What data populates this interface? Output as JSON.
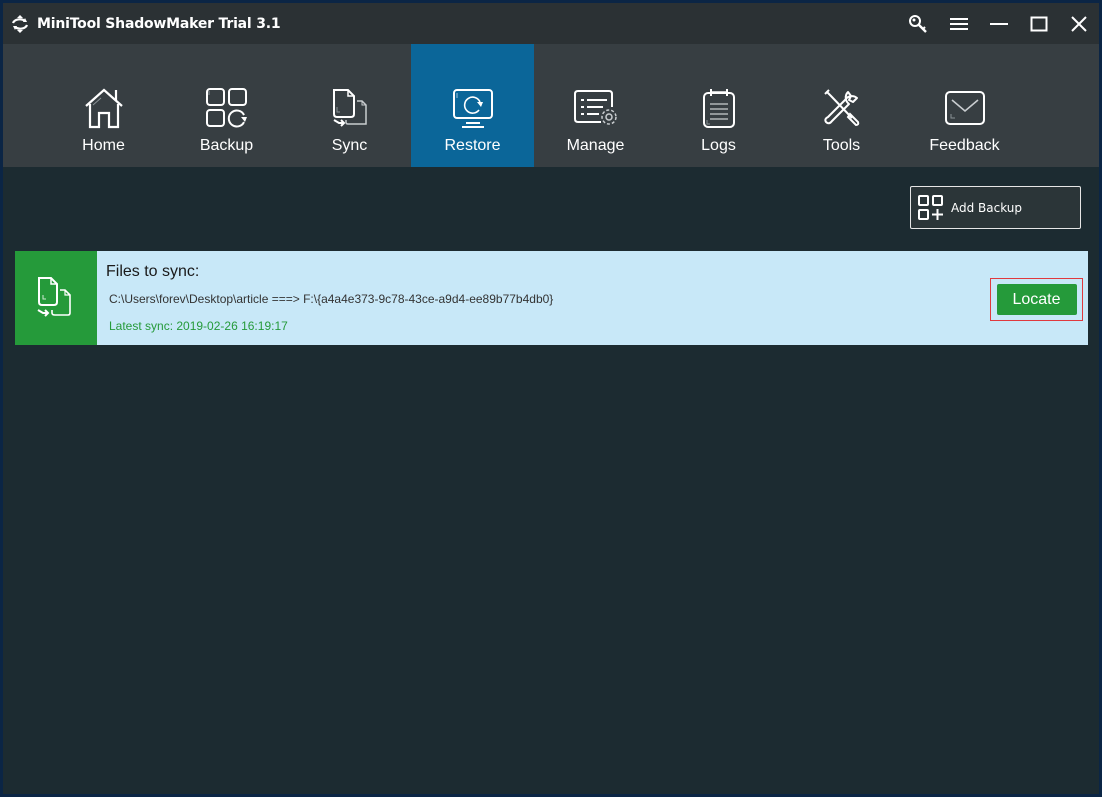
{
  "window": {
    "title": "MiniTool ShadowMaker Trial 3.1",
    "controls": [
      {
        "name": "key-icon",
        "label": "Register"
      },
      {
        "name": "menu-icon",
        "label": "Menu"
      },
      {
        "name": "minimize-icon",
        "label": "Minimize"
      },
      {
        "name": "maximize-icon",
        "label": "Maximize"
      },
      {
        "name": "close-icon",
        "label": "Close"
      }
    ]
  },
  "nav": {
    "active": "Restore",
    "items": [
      {
        "label": "Home",
        "icon": "home-icon"
      },
      {
        "label": "Backup",
        "icon": "backup-icon"
      },
      {
        "label": "Sync",
        "icon": "sync-icon"
      },
      {
        "label": "Restore",
        "icon": "restore-icon"
      },
      {
        "label": "Manage",
        "icon": "manage-icon"
      },
      {
        "label": "Logs",
        "icon": "logs-icon"
      },
      {
        "label": "Tools",
        "icon": "tools-icon"
      },
      {
        "label": "Feedback",
        "icon": "feedback-icon"
      }
    ]
  },
  "toolbar": {
    "add_backup_label": "Add Backup"
  },
  "tasks": [
    {
      "title": "Files to sync:",
      "path": "C:\\Users\\forev\\Desktop\\article ===> F:\\{a4a4e373-9c78-43ce-a9d4-ee89b77b4db0}",
      "latest_sync": "Latest sync: 2019-02-26 16:19:17",
      "action_label": "Locate"
    }
  ],
  "colors": {
    "accent_active": "#0b6699",
    "success_green": "#259a3a",
    "card_bg": "#c8e8f8",
    "highlight_red": "#e0393e"
  }
}
